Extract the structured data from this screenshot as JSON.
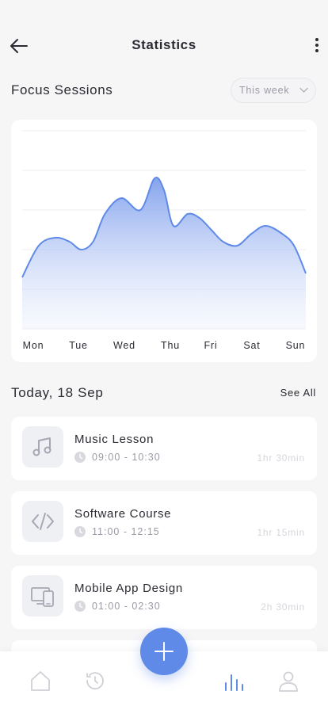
{
  "header": {
    "title": "Statistics"
  },
  "section": {
    "title": "Focus Sessions",
    "range_selected": "This week"
  },
  "chart_data": {
    "type": "area",
    "categories": [
      "Mon",
      "Tue",
      "Wed",
      "Thu",
      "Fri",
      "Sat",
      "Sun"
    ],
    "x": [
      0,
      0.35,
      0.7,
      1.0,
      1.25,
      1.5,
      1.75,
      2.1,
      2.5,
      2.8,
      3.0,
      3.2,
      3.5,
      3.75,
      4.0,
      4.25,
      4.55,
      4.85,
      5.15,
      5.5,
      5.75,
      6.0
    ],
    "values": [
      13,
      21,
      23,
      22,
      20,
      22,
      29,
      33,
      30,
      38,
      35,
      26,
      29,
      28,
      25,
      22,
      21,
      24,
      26,
      24,
      21,
      14
    ],
    "ylim": [
      0,
      50
    ],
    "grid": true,
    "color": "#5f8ae8"
  },
  "list": {
    "date_label": "Today, 18 Sep",
    "see_all": "See All",
    "items": [
      {
        "name": "Music Lesson",
        "time": "09:00 - 10:30",
        "duration": "1hr 30min",
        "icon": "music-note-icon"
      },
      {
        "name": "Software Course",
        "time": "11:00 - 12:15",
        "duration": "1hr 15min",
        "icon": "code-icon"
      },
      {
        "name": "Mobile App Design",
        "time": "01:00 - 02:30",
        "duration": "2h 30min",
        "icon": "devices-icon"
      }
    ]
  },
  "nav": {
    "items": [
      "home-icon",
      "history-icon",
      "statistics-icon",
      "profile-icon"
    ],
    "active": "statistics-icon"
  },
  "colors": {
    "accent": "#5f8ae8",
    "muted": "#9a9aa6",
    "background": "#f6f6f7"
  }
}
